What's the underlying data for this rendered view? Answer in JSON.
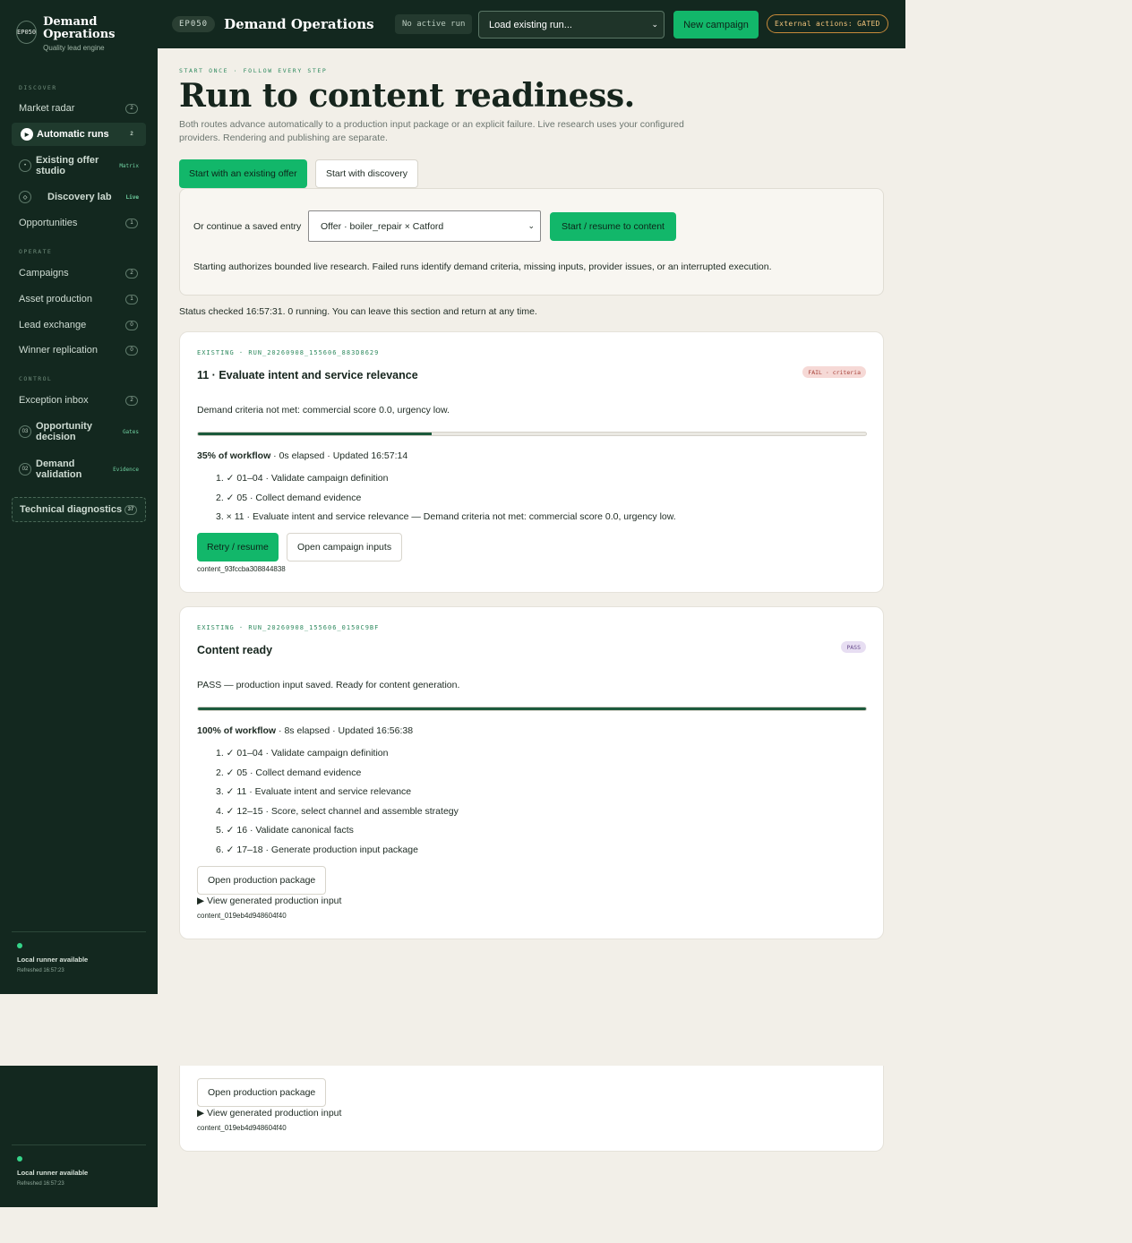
{
  "brand": {
    "logo": "EP050",
    "name": "Demand Operations",
    "tagline": "Quality lead engine"
  },
  "sidebar": {
    "discover_label": "DISCOVER",
    "operate_label": "OPERATE",
    "control_label": "CONTROL",
    "items": [
      {
        "label": "Market radar",
        "count": "2"
      },
      {
        "label": "Automatic runs",
        "count": "2",
        "icon": "play-icon"
      },
      {
        "label": "Existing offer studio",
        "tag": "Matrix",
        "icon": "dot"
      },
      {
        "label": "Discovery lab",
        "tag": "Live",
        "icon": "dot"
      },
      {
        "label": "Opportunities",
        "count": "1"
      },
      {
        "label": "Campaigns",
        "count": "2"
      },
      {
        "label": "Asset production",
        "count": "1"
      },
      {
        "label": "Lead exchange",
        "count": "0"
      },
      {
        "label": "Winner replication",
        "count": "0"
      },
      {
        "label": "Exception inbox",
        "count": "2"
      },
      {
        "label": "Opportunity decision",
        "tag": "Gates",
        "num": "03"
      },
      {
        "label": "Demand validation",
        "tag": "Evidence",
        "num": "02"
      },
      {
        "label": "Technical diagnostics",
        "count": "37"
      }
    ],
    "runner": {
      "status": "Local runner available",
      "refreshed": "Refreshed 16:57:23"
    }
  },
  "topbar": {
    "ep": "EP050",
    "title": "Demand Operations",
    "run_status": "No active run",
    "load_placeholder": "Load existing run...",
    "new_campaign": "New campaign",
    "external": "External actions: GATED"
  },
  "main": {
    "kicker": "START ONCE · FOLLOW EVERY STEP",
    "title": "Run to content readiness.",
    "lead": "Both routes advance automatically to a production input package or an explicit failure. Live research uses your configured providers. Rendering and publishing are separate.",
    "tab_existing": "Start with an existing offer",
    "tab_discovery": "Start with discovery",
    "entry_label": "Or continue a saved entry",
    "entry_value": "Offer · boiler_repair × Catford",
    "start_button": "Start / resume to content",
    "entry_note": "Starting authorizes bounded live research. Failed runs identify demand criteria, missing inputs, provider issues, or an interrupted execution.",
    "status": "Status checked 16:57:31. 0 running. You can leave this section and return at any time."
  },
  "runs": [
    {
      "id": "EXISTING · RUN_20260908_155606_883D8629",
      "title": "11 · Evaluate intent and service relevance",
      "badge": "FAIL · criteria",
      "message": "Demand criteria not met: commercial score 0.0, urgency low.",
      "progress": 0.35,
      "meta_bold": "35% of workflow",
      "meta_rest": " · 0s elapsed · Updated 16:57:14",
      "steps": [
        "1. ✓ 01–04 · Validate campaign definition",
        "2. ✓ 05 · Collect demand evidence",
        "3. × 11 · Evaluate intent and service relevance — Demand criteria not met: commercial score 0.0, urgency low."
      ],
      "retry": "Retry / resume",
      "open_inputs": "Open campaign inputs",
      "content_id": "content_93fccba308844838"
    },
    {
      "id": "EXISTING · RUN_20260908_155606_0150C9BF",
      "title": "Content ready",
      "badge": "PASS",
      "message": "PASS — production input saved. Ready for content generation.",
      "progress": 1.0,
      "meta_bold": "100% of workflow",
      "meta_rest": " · 8s elapsed · Updated 16:56:38",
      "steps": [
        "1. ✓ 01–04 · Validate campaign definition",
        "2. ✓ 05 · Collect demand evidence",
        "3. ✓ 11 · Evaluate intent and service relevance",
        "4. ✓ 12–15 · Score, select channel and assemble strategy",
        "5. ✓ 16 · Validate canonical facts",
        "6. ✓ 17–18 · Generate production input package"
      ],
      "open_package": "Open production package",
      "view_input": "View generated production input",
      "content_id": "content_019eb4d948604f40"
    }
  ]
}
